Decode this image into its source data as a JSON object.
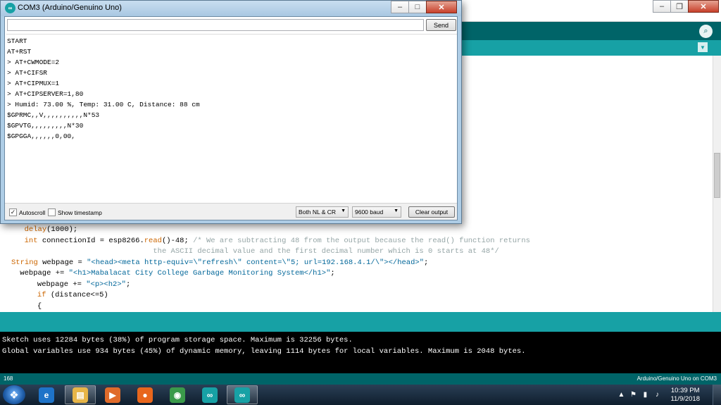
{
  "ide": {
    "editor_lines": [
      {
        "parts": [
          {
            "t": "  "
          },
          {
            "t": "delay",
            "c": "kw"
          },
          {
            "t": "(1000);"
          }
        ]
      },
      {
        "parts": [
          {
            "t": "  "
          },
          {
            "t": "int",
            "c": "ty"
          },
          {
            "t": " connectionId = esp8266."
          },
          {
            "t": "read",
            "c": "kw"
          },
          {
            "t": "()-48; "
          },
          {
            "t": "/* We are subtracting 48 from the output because the read() function returns",
            "c": "cmt"
          }
        ]
      },
      {
        "parts": [
          {
            "t": "                               "
          },
          {
            "t": "the ASCII decimal value and the first decimal number which is 0 starts at 48*/",
            "c": "cmt"
          }
        ]
      },
      {
        "parts": [
          {
            "t": "String",
            "c": "ty"
          },
          {
            "t": " webpage = "
          },
          {
            "t": "\"<head><meta http-equiv=\\\"refresh\\\" content=\\\"5; url=192.168.4.1/\\\"></head>\"",
            "c": "str"
          },
          {
            "t": ";"
          }
        ]
      },
      {
        "parts": [
          {
            "t": " webpage += "
          },
          {
            "t": "\"<h1>Mabalacat City College Garbage Monitoring System</h1>\"",
            "c": "str"
          },
          {
            "t": ";"
          }
        ]
      },
      {
        "parts": [
          {
            "t": "   webpage += "
          },
          {
            "t": "\"<p><h2>\"",
            "c": "str"
          },
          {
            "t": ";"
          }
        ]
      },
      {
        "parts": [
          {
            "t": "   "
          },
          {
            "t": "if",
            "c": "kw"
          },
          {
            "t": " (distance<=5)"
          }
        ]
      },
      {
        "parts": [
          {
            "t": "   {"
          }
        ]
      }
    ],
    "console_lines": [
      "Sketch uses 12284 bytes (38%) of program storage space. Maximum is 32256 bytes.",
      "Global variables use 934 bytes (45%) of dynamic memory, leaving 1114 bytes for local variables. Maximum is 2048 bytes."
    ],
    "status": {
      "line": "168",
      "board": "Arduino/Genuino Uno on COM3"
    }
  },
  "serial_monitor": {
    "title": "COM3 (Arduino/Genuino Uno)",
    "input_value": "",
    "send_label": "Send",
    "output_lines": [
      "START",
      "AT+RST",
      "> AT+CWMODE=2",
      "> AT+CIFSR",
      "> AT+CIPMUX=1",
      "> AT+CIPSERVER=1,80",
      "> Humid: 73.00 %, Temp: 31.00 C, Distance: 88 cm",
      "$GPRMC,,V,,,,,,,,,,N*53",
      "$GPVTG,,,,,,,,,N*30",
      "$GPGGA,,,,,,0,00,"
    ],
    "autoscroll_label": "Autoscroll",
    "autoscroll_checked": true,
    "timestamp_label": "Show timestamp",
    "timestamp_checked": false,
    "line_ending": "Both NL & CR",
    "baud": "9600 baud",
    "clear_label": "Clear output"
  },
  "taskbar": {
    "apps": [
      {
        "name": "internet-explorer",
        "color": "#1e73c8",
        "glyph": "e"
      },
      {
        "name": "file-explorer",
        "color": "#e7b548",
        "glyph": "▤"
      },
      {
        "name": "media-player",
        "color": "#e06b2a",
        "glyph": "▶"
      },
      {
        "name": "firefox",
        "color": "#e8661c",
        "glyph": "●"
      },
      {
        "name": "chrome",
        "color": "#3a9a4a",
        "glyph": "◉"
      },
      {
        "name": "arduino",
        "color": "#17a1a5",
        "glyph": "∞"
      },
      {
        "name": "arduino-active",
        "color": "#17a1a5",
        "glyph": "∞"
      }
    ],
    "clock": {
      "time": "10:39 PM",
      "date": "11/9/2018"
    }
  }
}
